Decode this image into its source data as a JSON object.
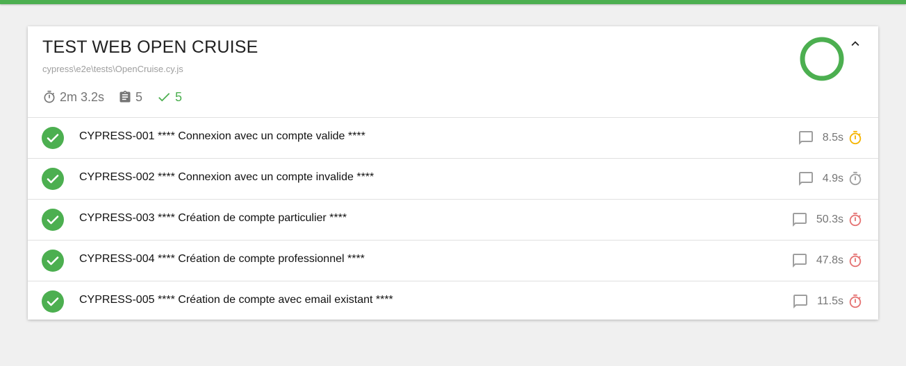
{
  "colors": {
    "accent": "#4caf50",
    "speed_medium": "#f5b400",
    "speed_fast": "#9e9e9e",
    "speed_slow": "#e57373"
  },
  "suite": {
    "title": "TEST WEB OPEN CRUISE",
    "file": "cypress\\e2e\\tests\\OpenCruise.cy.js",
    "duration": "2m 3.2s",
    "tests_count": "5",
    "passed_count": "5",
    "pass_ratio": 1.0
  },
  "tests": [
    {
      "title": "CYPRESS-001 **** Connexion avec un compte valide ****",
      "duration": "8.5s",
      "speed": "medium",
      "status": "passed"
    },
    {
      "title": "CYPRESS-002 **** Connexion avec un compte invalide ****",
      "duration": "4.9s",
      "speed": "fast",
      "status": "passed"
    },
    {
      "title": "CYPRESS-003 **** Création de compte particulier ****",
      "duration": "50.3s",
      "speed": "slow",
      "status": "passed"
    },
    {
      "title": "CYPRESS-004 **** Création de compte professionnel ****",
      "duration": "47.8s",
      "speed": "slow",
      "status": "passed"
    },
    {
      "title": "CYPRESS-005 **** Création de compte avec email existant ****",
      "duration": "11.5s",
      "speed": "slow",
      "status": "passed"
    }
  ],
  "icons": {
    "duration": "stopwatch-icon",
    "tests": "clipboard-icon",
    "passed": "check-icon",
    "collapse": "chevron-up-icon",
    "status": "check-circle-icon",
    "comment": "comment-icon",
    "speed": "timer-icon"
  }
}
